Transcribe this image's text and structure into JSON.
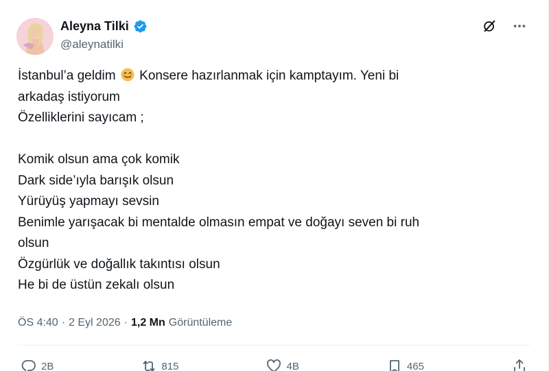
{
  "author": {
    "name": "Aleyna Tilki",
    "handle": "@aleynatilki",
    "verified": true
  },
  "tweet": {
    "line1_before_emoji": "İstanbul’a geldim",
    "emoji": "face-savoring-food-emoji",
    "line1_after_emoji": " Konsere hazırlanmak için kamptayım. Yeni bi",
    "line2": "arkadaş istiyorum",
    "line3": "Özelliklerini sayıcam ;",
    "line4": "Komik olsun ama çok komik",
    "line5": "Dark side’ıyla barışık olsun",
    "line6": "Yürüyüş yapmayı sevsin",
    "line7": "Benimle yarışacak bi mentalde olmasın empat ve doğayı seven bi ruh",
    "line8": "olsun",
    "line9": "Özgürlük ve doğallık takıntısı olsun",
    "line10": "He bi de üstün zekalı olsun"
  },
  "meta": {
    "time": "ÖS 4:40",
    "separator": "·",
    "date": "2 Eyl 2026",
    "views_count": "1,2 Mn",
    "views_label": "Görüntüleme"
  },
  "actions": {
    "replies": "2B",
    "reposts": "815",
    "likes": "4B",
    "bookmarks": "465"
  },
  "icons": {
    "grok": "grok-icon",
    "more": "more-icon",
    "reply": "reply-icon",
    "repost": "repost-icon",
    "like": "heart-icon",
    "bookmark": "bookmark-icon",
    "share": "share-icon"
  },
  "colors": {
    "text": "#0f1419",
    "secondary": "#536471",
    "verified": "#1d9bf0"
  }
}
